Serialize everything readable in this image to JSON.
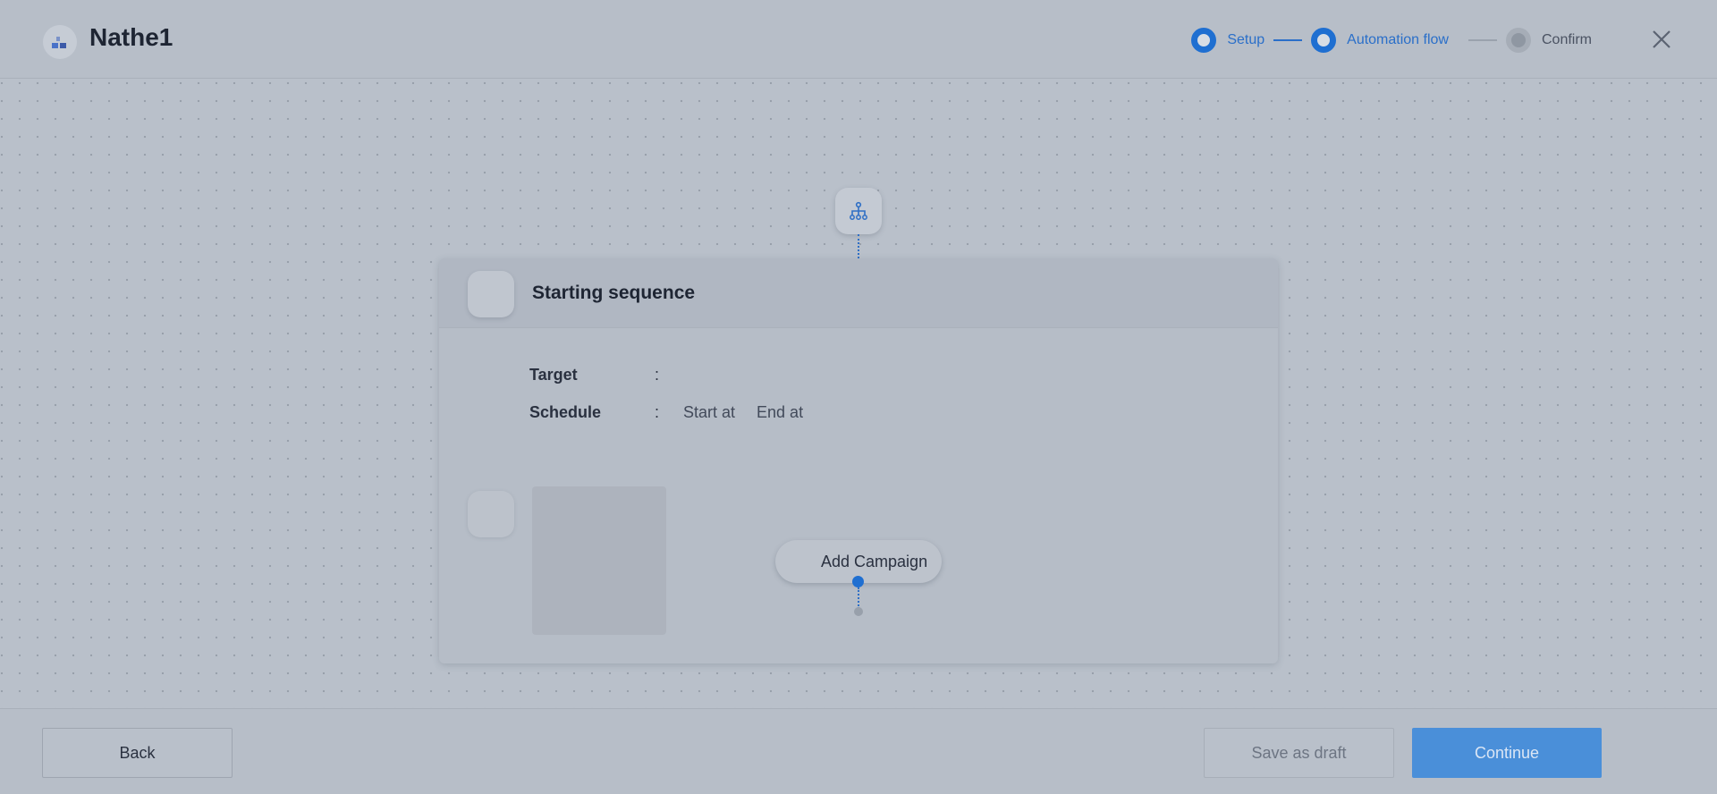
{
  "header": {
    "title": "Nathe1",
    "steps": [
      {
        "label": "Setup",
        "state": "done"
      },
      {
        "label": "Automation flow",
        "state": "active"
      },
      {
        "label": "Confirm",
        "state": "pending"
      }
    ],
    "close_icon": "close-icon"
  },
  "canvas": {
    "trigger_icon": "sitemap-icon",
    "card": {
      "title": "Starting sequence",
      "target_label": "Target",
      "target_colon": ":",
      "schedule_label": "Schedule",
      "schedule_colon": ":",
      "start_label": "Start at",
      "end_label": "End at",
      "add_campaign_label": "Add Campaign"
    }
  },
  "footer": {
    "back_label": "Back",
    "draft_label": "Save as draft",
    "continue_label": "Continue"
  },
  "colors": {
    "accent": "#1f6fd1",
    "overlay_bg": "#b9c0ca",
    "continue_bg": "#4a8fd9"
  }
}
